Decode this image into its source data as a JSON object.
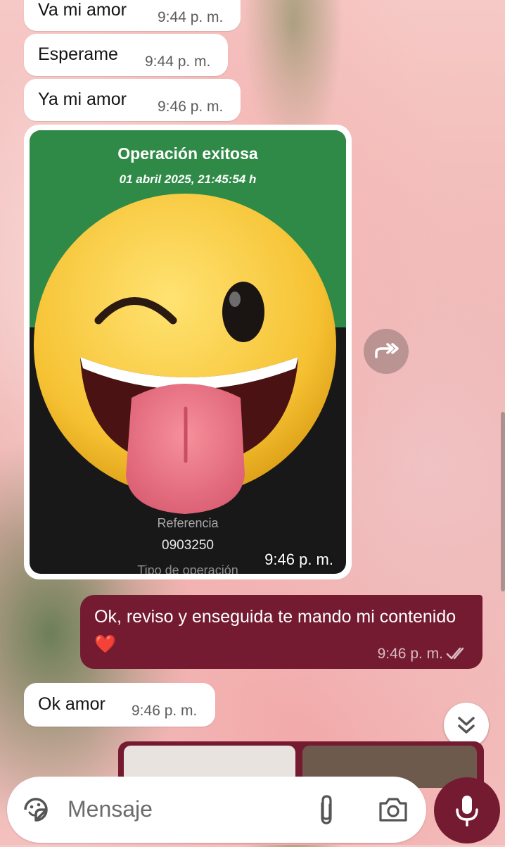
{
  "messages": [
    {
      "text": "Va mi amor",
      "time": "9:44 p. m."
    },
    {
      "text": "Esperame",
      "time": "9:44 p. m."
    },
    {
      "text": "Ya mi amor",
      "time": "9:46 p. m."
    }
  ],
  "receipt": {
    "title": "Operación exitosa",
    "date": "01 abril 2025, 21:45:54 h",
    "reference_label": "Referencia",
    "reference_value": "0903250",
    "operation_type_label": "Tipo de operación",
    "time": "9:46 p. m."
  },
  "outgoing": {
    "text": "Ok, reviso y enseguida te  mando mi contenido ❤️",
    "time": "9:46 p. m.",
    "status": "read"
  },
  "incoming_last": {
    "text": "Ok amor",
    "time": "9:46 p. m."
  },
  "composer": {
    "placeholder": "Mensaje"
  },
  "icons": {
    "forward": "forward-icon",
    "scroll_down": "double-chevron-down-icon",
    "sticker": "sticker-icon",
    "attach": "paperclip-icon",
    "camera": "camera-icon",
    "mic": "microphone-icon"
  },
  "colors": {
    "outgoing_bubble": "#741a31",
    "receipt_green": "#2f8a47",
    "receipt_dark": "#181818",
    "emoji_yellow": "#f6c233"
  }
}
